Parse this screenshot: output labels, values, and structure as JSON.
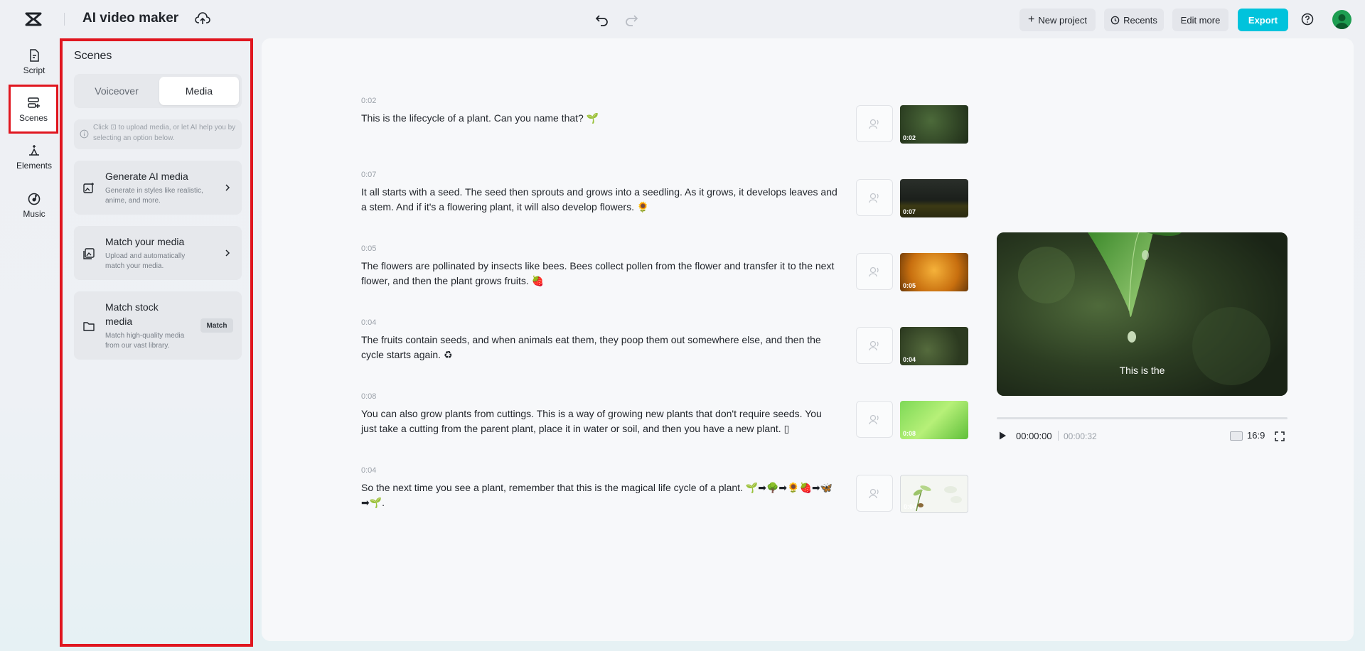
{
  "app": {
    "title": "AI video maker"
  },
  "toolbar": {
    "new_project": "New project",
    "recents": "Recents",
    "edit_more": "Edit more",
    "export": "Export"
  },
  "rail": [
    {
      "label": "Script",
      "icon": "script-icon"
    },
    {
      "label": "Scenes",
      "icon": "scenes-icon",
      "active": true
    },
    {
      "label": "Elements",
      "icon": "elements-icon"
    },
    {
      "label": "Music",
      "icon": "music-icon"
    }
  ],
  "panel": {
    "title": "Scenes",
    "tabs": {
      "voiceover": "Voiceover",
      "media": "Media",
      "selected": "Media"
    },
    "hint": "Click ⊡ to upload media, or let AI help you by selecting an option below.",
    "cards": [
      {
        "title": "Generate AI media",
        "desc": "Generate in styles like realistic, anime, and more."
      },
      {
        "title": "Match your media",
        "desc": "Upload and automatically match your media."
      },
      {
        "title": "Match stock media",
        "desc": "Match high-quality media from our vast library.",
        "action": "Match"
      }
    ]
  },
  "scenes": [
    {
      "time": "0:02",
      "text": "This is the lifecycle of a plant. Can you name that? 🌱",
      "thumb_dur": "0:02"
    },
    {
      "time": "0:07",
      "text": "It all starts with a seed. The seed then sprouts and grows into a seedling. As it grows, it develops leaves and a stem. And if it's a flowering plant, it will also develop flowers. 🌻",
      "thumb_dur": "0:07"
    },
    {
      "time": "0:05",
      "text": "The flowers are pollinated by insects like bees. Bees collect pollen from the flower and transfer it to the next flower, and then the plant grows fruits. 🍓",
      "thumb_dur": "0:05"
    },
    {
      "time": "0:04",
      "text": "The fruits contain seeds, and when animals eat them, they poop them out somewhere else, and then the cycle starts again. ♻",
      "thumb_dur": "0:04"
    },
    {
      "time": "0:08",
      "text": "You can also grow plants from cuttings. This is a way of growing new plants that don't require seeds. You just take a cutting from the parent plant, place it in water or soil, and then you have a new plant. ▯",
      "thumb_dur": "0:08"
    },
    {
      "time": "0:04",
      "text": "So the next time you see a plant, remember that this is the magical life cycle of a plant. 🌱➡🌳➡🌻🍓➡🦋➡🌱.",
      "thumb_dur": "0:04"
    }
  ],
  "preview": {
    "caption": "This is the",
    "current_time": "00:00:00",
    "total_time": "00:00:32",
    "ratio": "16:9",
    "progress": 0
  }
}
